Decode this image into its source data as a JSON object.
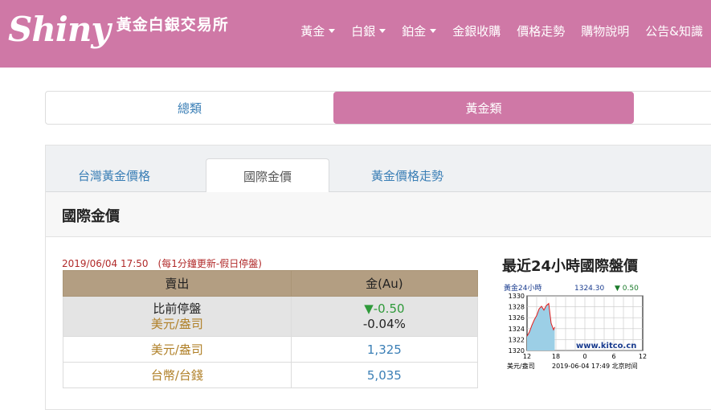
{
  "header": {
    "logo_script": "Shiny",
    "logo_text": "黃金白銀交易所",
    "nav": [
      {
        "label": "黃金",
        "dropdown": true
      },
      {
        "label": "白銀",
        "dropdown": true
      },
      {
        "label": "鉑金",
        "dropdown": true
      },
      {
        "label": "金銀收購",
        "dropdown": false
      },
      {
        "label": "價格走勢",
        "dropdown": false
      },
      {
        "label": "購物說明",
        "dropdown": false
      },
      {
        "label": "公告&知識",
        "dropdown": false
      }
    ]
  },
  "categories": {
    "all": "總類",
    "gold": "黃金類"
  },
  "tabs": {
    "tw_price": "台灣黃金價格",
    "intl_price": "國際金價",
    "trend": "黃金價格走勢"
  },
  "panel": {
    "heading": "國際金價"
  },
  "update_text": "2019/06/04 17:50　(每1分鐘更新-假日停盤)",
  "table": {
    "headers": [
      "賣出",
      "金(Au)"
    ],
    "close_row": {
      "label_top": "比前停盤",
      "label_bottom": "美元/盎司",
      "change": "▼-0.50",
      "change_pct": "-0.04%"
    },
    "rows": [
      {
        "label": "美元/盎司",
        "value": "1,325"
      },
      {
        "label": "台幣/台錢",
        "value": "5,035"
      }
    ]
  },
  "chart": {
    "title": "最近24小時國際盤價",
    "caption_left": "黃金24小時",
    "caption_price": "1324.30",
    "caption_change": "▼ 0.50",
    "watermark": "www.kitco.cn",
    "unit": "美元/盎司",
    "timestamp": "2019-06-04 17:49 北京时间",
    "colors": {
      "line": "#e11d1d",
      "fill": "#9ccfe6",
      "axis": "#000000"
    }
  },
  "chart_data": {
    "type": "area",
    "title": "黃金24小時",
    "ylim": [
      1320,
      1330
    ],
    "yticks": [
      1320,
      1322,
      1324,
      1326,
      1328,
      1330
    ],
    "xticks": [
      "12",
      "18",
      "0",
      "6",
      "12"
    ],
    "x": [
      0,
      0.5,
      1,
      1.5,
      2,
      2.5,
      3,
      3.5,
      4,
      4.5,
      5,
      5.5,
      5.75
    ],
    "values": [
      1322.6,
      1323.4,
      1324.6,
      1325.6,
      1326.4,
      1327.6,
      1328.1,
      1327.4,
      1328.2,
      1328.6,
      1325.0,
      1323.8,
      1324.3
    ]
  }
}
